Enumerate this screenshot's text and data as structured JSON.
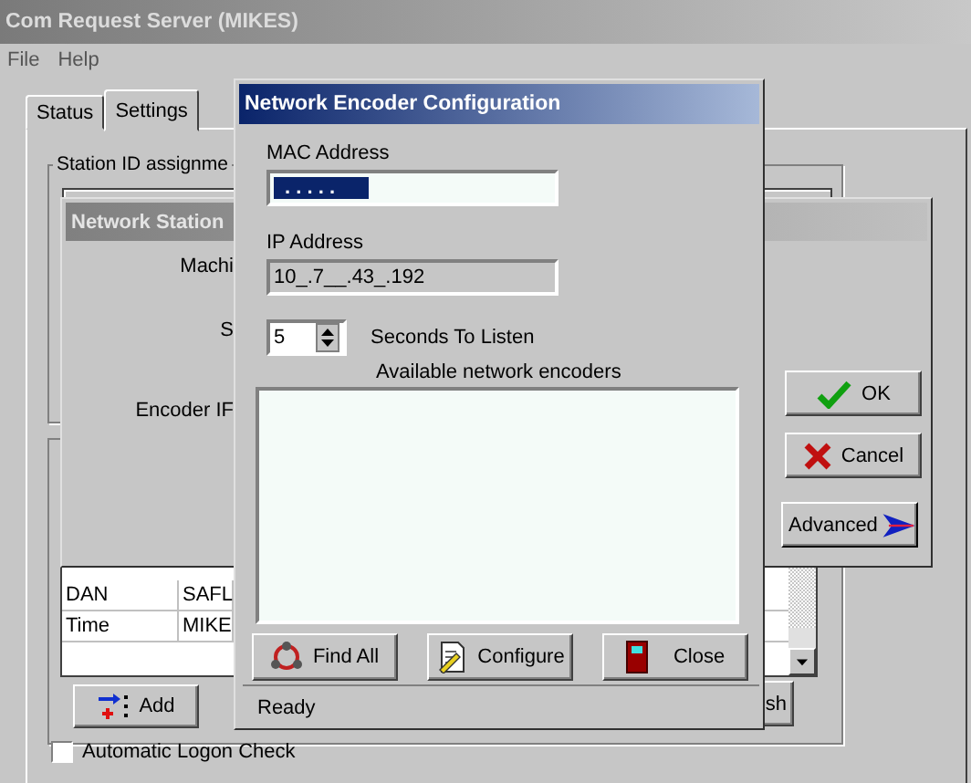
{
  "window": {
    "title": "Com Request Server  (MIKES)"
  },
  "menu": [
    "File",
    "Help"
  ],
  "tabs": [
    {
      "label": "Status",
      "selected": false
    },
    {
      "label": "Settings",
      "selected": true
    }
  ],
  "station_group": {
    "label": "Station ID assignme"
  },
  "station_dialog": {
    "title": "Network Station",
    "labels": [
      "Machi",
      "S",
      "Encoder IF"
    ],
    "buttons": [
      {
        "kind": "ok",
        "label": "OK"
      },
      {
        "kind": "cancel",
        "label": "Cancel"
      },
      {
        "kind": "advanced",
        "label": "Advanced"
      }
    ]
  },
  "stations_table": {
    "rows": [
      [
        "DAN",
        "SAFL"
      ],
      [
        "Time",
        "MIKE"
      ]
    ]
  },
  "bottom_buttons": [
    {
      "kind": "add",
      "label": "Add"
    },
    {
      "kind": "partial",
      "label": "sh"
    }
  ],
  "auto_logon": {
    "label": "Automatic Logon Check",
    "checked": false
  },
  "encoder_dialog": {
    "title": "Network Encoder Configuration",
    "mac": {
      "label": "MAC Address",
      "value": ".   .   .   .   .",
      "selected": true
    },
    "ip": {
      "label": "IP Address",
      "value": "10_.7__.43_.192",
      "disabled": true
    },
    "listen": {
      "value": "5",
      "label": "Seconds To Listen"
    },
    "list_label": "Available network encoders",
    "buttons": [
      {
        "kind": "find",
        "label": "Find All"
      },
      {
        "kind": "configure",
        "label": "Configure"
      },
      {
        "kind": "close",
        "label": "Close"
      }
    ],
    "status": "Ready"
  }
}
